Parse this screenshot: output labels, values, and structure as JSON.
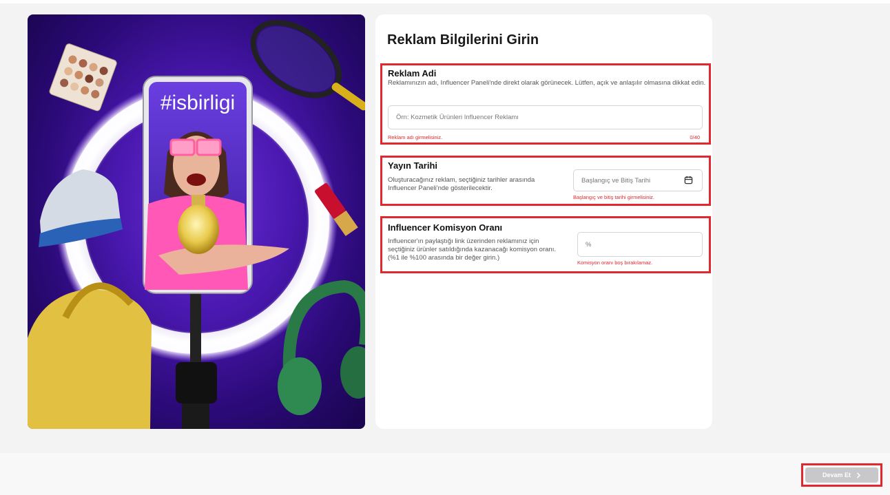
{
  "hero": {
    "hashtag": "#isbirligi"
  },
  "form": {
    "title": "Reklam Bilgilerini Girin",
    "name_section": {
      "title": "Reklam Adi",
      "description": "Reklamınızın adı, Influencer Paneli'nde direkt olarak görünecek. Lütfen, açık ve anlaşılır olmasına dikkat edin.",
      "placeholder": "Örn: Kozmetik Ürünleri Influencer Reklamı",
      "error": "Reklam adı girmelisiniz.",
      "counter": "0/40"
    },
    "date_section": {
      "title": "Yayın Tarihi",
      "description": "Oluşturacağınız reklam, seçtiğiniz tarihler arasında Influencer Paneli'nde gösterilecektir.",
      "placeholder": "Başlangıç ve Bitiş Tarihi",
      "icon": "calendar-icon",
      "error": "Başlangıç ve bitiş tarihi girmelisiniz."
    },
    "rate_section": {
      "title": "Influencer Komisyon Oranı",
      "description": "Influencer'ın paylaştığı link üzerinden reklamınız için seçtiğiniz ürünler satıldığında kazanacağı komisyon oranı. (%1 ile %100 arasında bir değer girin.)",
      "placeholder": "%",
      "error": "Komisyon oranı boş bırakılamaz."
    }
  },
  "footer": {
    "continue_label": "Devam Et",
    "continue_icon": "chevron-right-icon"
  },
  "colors": {
    "error_red": "#e0282e",
    "disabled_button": "#c8c8cb",
    "hero_purple": "#4a18b0"
  }
}
